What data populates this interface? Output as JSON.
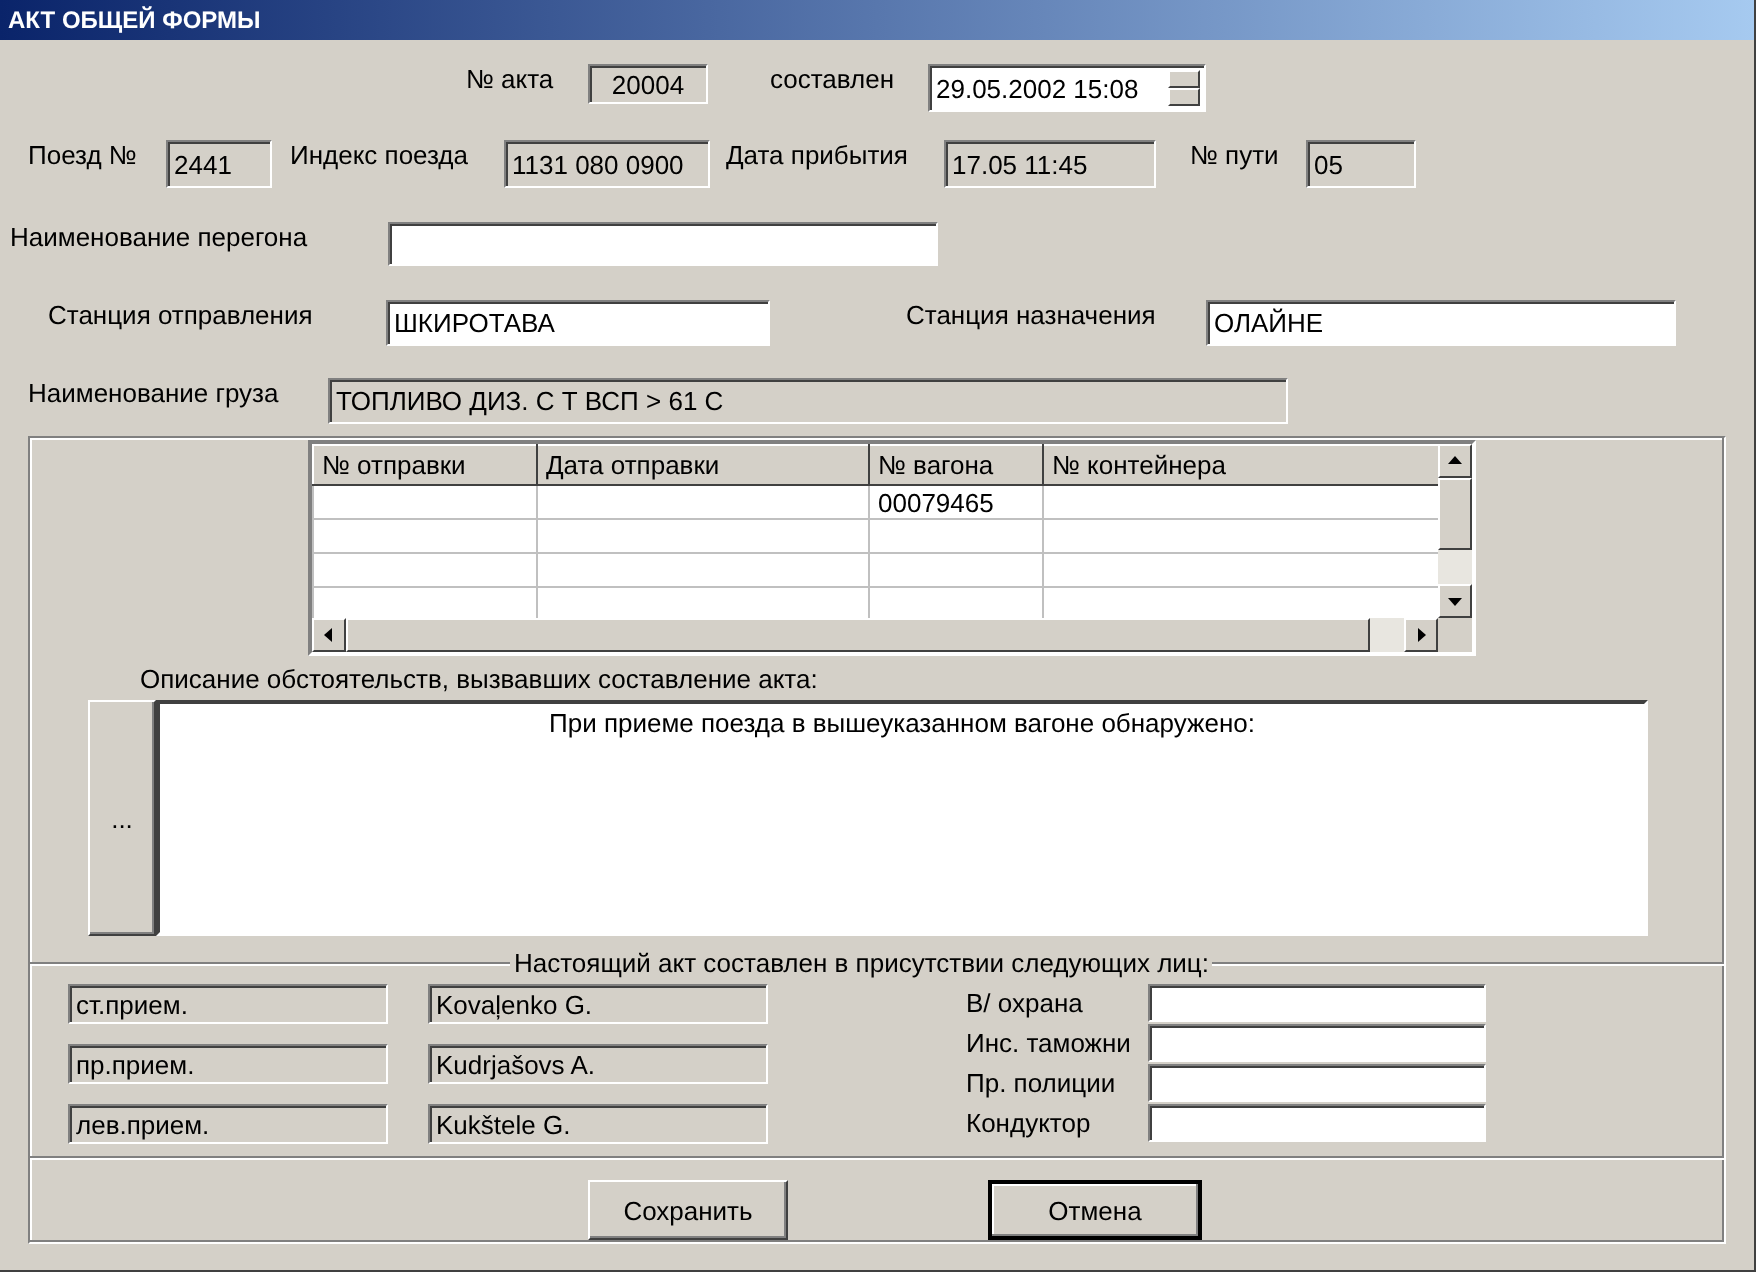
{
  "window": {
    "title": "АКТ ОБЩЕЙ ФОРМЫ"
  },
  "act": {
    "number_label": "№ акта",
    "number": "20004",
    "date_label": "составлен",
    "date": "29.05.2002 15:08"
  },
  "train_fields": [
    {
      "label": "Поезд №",
      "value": "2441"
    },
    {
      "label": "Индекс поезда",
      "value": "1131 080 0900"
    },
    {
      "label": "Дата прибытия",
      "value": "17.05 11:45"
    },
    {
      "label": "№ пути",
      "value": "05"
    }
  ],
  "section": {
    "label": "Наименование перегона"
  },
  "stations": [
    {
      "label": "Станция отправления",
      "value": "ШКИРОТАВА"
    },
    {
      "label": "Станция назначения",
      "value": "ОЛАЙНЕ"
    }
  ],
  "cargo": {
    "label": "Наименование груза",
    "value": "ТОПЛИВО ДИЗ. С Т ВСП > 61 С"
  },
  "table": {
    "columns": [
      "№ отправки",
      "Дата отправки",
      "№ вагона",
      "№ контейнера"
    ],
    "rows": [
      {
        "cells": [
          null,
          null,
          "00079465",
          null
        ]
      }
    ]
  },
  "description": {
    "label": "Описание обстоятельств, вызвавших составление акта:",
    "button": "...",
    "text": "При приеме поезда в вышеуказанном вагоне обнаружено:"
  },
  "witnesses": {
    "legend": "Настоящий акт составлен в присутствии следующих лиц:",
    "people": [
      {
        "role": "ст.прием.",
        "name": "Kovaļenko G."
      },
      {
        "role": "пр.прием.",
        "name": "Kudrjašovs A."
      },
      {
        "role": "лев.прием.",
        "name": "Kukštele G."
      }
    ],
    "officials": [
      {
        "label": "В/ охрана"
      },
      {
        "label": "Инс. таможни"
      },
      {
        "label": "Пр. полиции"
      },
      {
        "label": "Кондуктор"
      }
    ]
  },
  "buttons": [
    {
      "label": "Сохранить",
      "default": false
    },
    {
      "label": "Отмена",
      "default": true
    }
  ]
}
